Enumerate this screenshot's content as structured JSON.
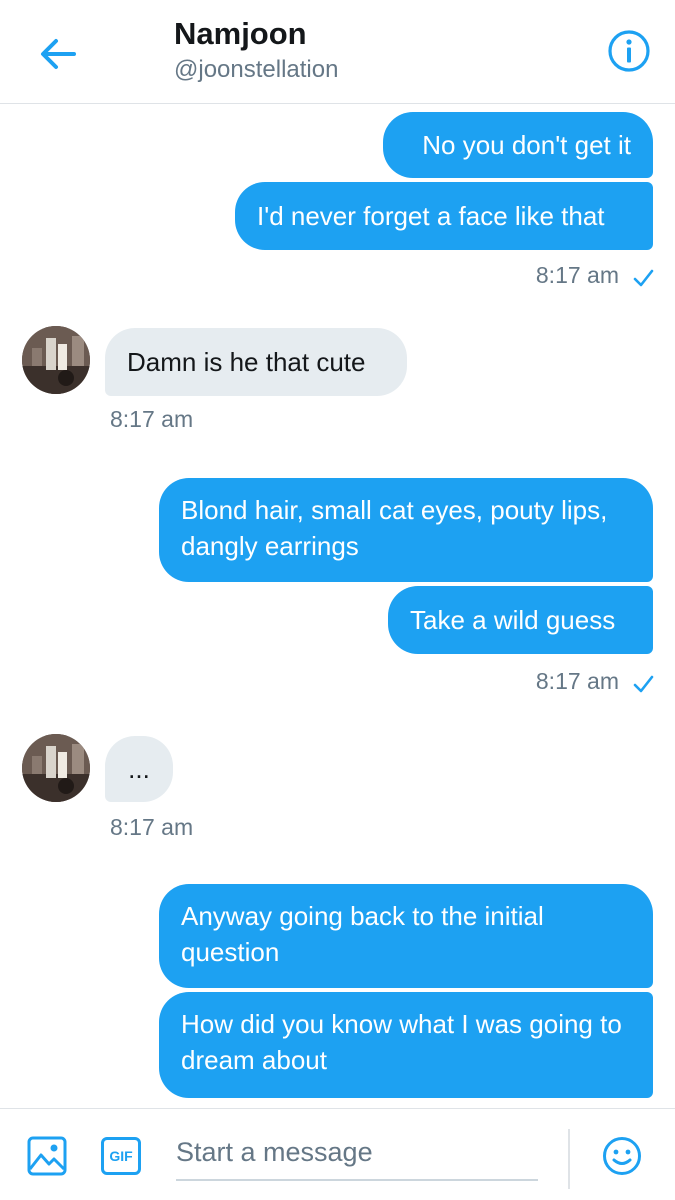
{
  "header": {
    "title": "Namjoon",
    "handle": "@joonstellation",
    "back_icon": "arrow-left-icon",
    "info_icon": "info-icon"
  },
  "messages": [
    {
      "direction": "out",
      "text": "No you don't get it"
    },
    {
      "direction": "out",
      "text": "I'd never forget a face like that"
    },
    {
      "direction": "out",
      "timestamp": "8:17 am",
      "read": true
    },
    {
      "direction": "in",
      "text": "Damn is he that cute"
    },
    {
      "direction": "in",
      "timestamp": "8:17 am"
    },
    {
      "direction": "out",
      "text": "Blond hair, small cat eyes, pouty lips, dangly earrings"
    },
    {
      "direction": "out",
      "text": "Take a wild guess"
    },
    {
      "direction": "out",
      "timestamp": "8:17 am",
      "read": true
    },
    {
      "direction": "in",
      "text": "..."
    },
    {
      "direction": "in",
      "timestamp": "8:17 am"
    },
    {
      "direction": "out",
      "text": "Anyway going back to the initial question"
    },
    {
      "direction": "out",
      "text": "How did you know what I was going to dream about"
    }
  ],
  "composer": {
    "placeholder": "Start a message",
    "gif_label": "GIF",
    "image_icon": "image-icon",
    "emoji_icon": "emoji-icon"
  },
  "colors": {
    "accent": "#1da1f2",
    "incoming_bubble": "#e6ecf0",
    "secondary_text": "#657786"
  }
}
